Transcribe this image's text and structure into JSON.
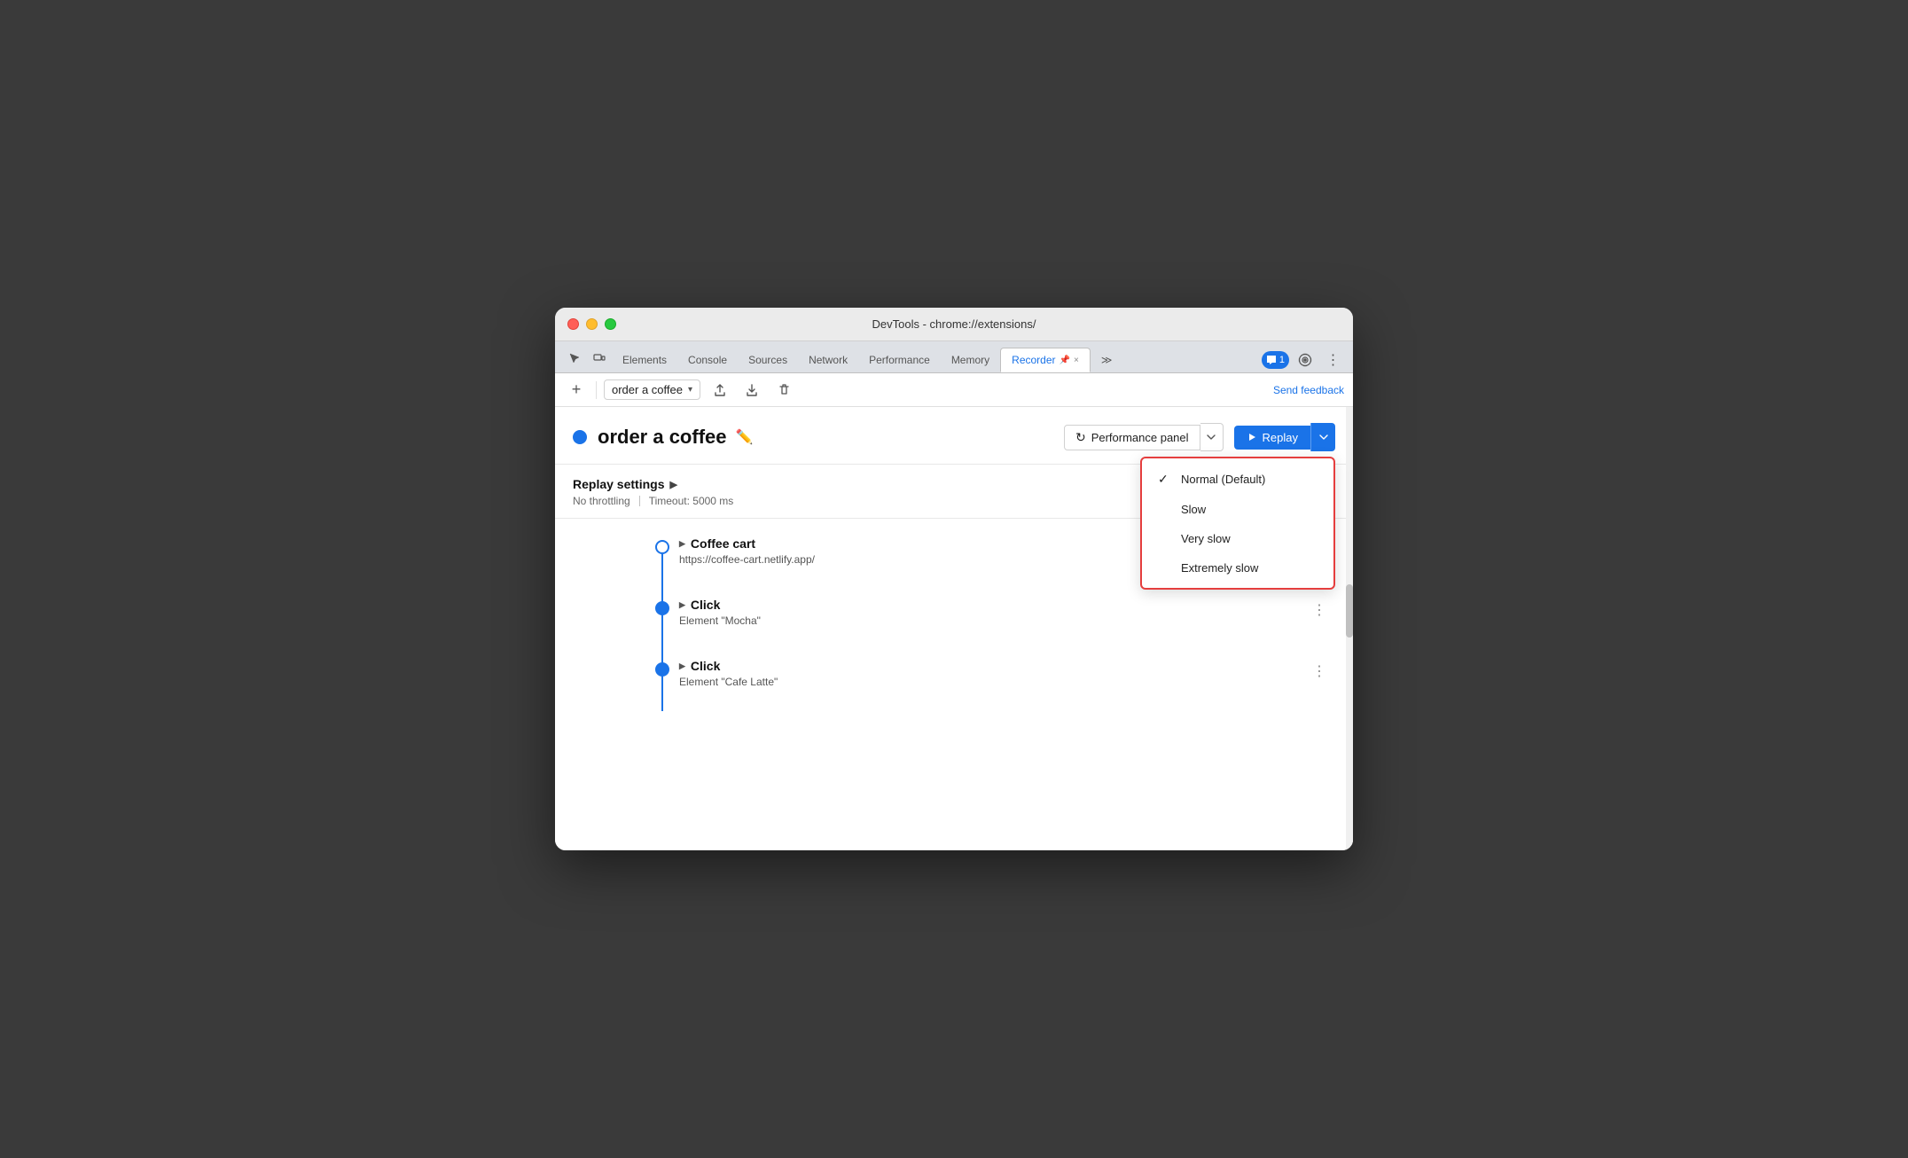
{
  "window": {
    "title": "DevTools - chrome://extensions/"
  },
  "tabs": {
    "items": [
      {
        "label": "Elements",
        "active": false
      },
      {
        "label": "Console",
        "active": false
      },
      {
        "label": "Sources",
        "active": false
      },
      {
        "label": "Network",
        "active": false
      },
      {
        "label": "Performance",
        "active": false
      },
      {
        "label": "Memory",
        "active": false
      },
      {
        "label": "Recorder",
        "active": true
      },
      {
        "label": "≫",
        "active": false
      }
    ],
    "chat_badge": "1",
    "recorder_pin": "📌",
    "recorder_close": "×"
  },
  "toolbar": {
    "add_icon": "+",
    "recording_name": "order a coffee",
    "chevron": "▾",
    "upload_icon": "↑",
    "download_icon": "↓",
    "delete_icon": "🗑",
    "send_feedback": "Send feedback"
  },
  "recording": {
    "title": "order a coffee",
    "edit_icon": "✏️",
    "perf_panel_label": "Performance panel",
    "replay_label": "Replay"
  },
  "replay_settings": {
    "title": "Replay settings",
    "arrow": "▶",
    "no_throttling": "No throttling",
    "timeout": "Timeout: 5000 ms"
  },
  "speed_dropdown": {
    "options": [
      {
        "label": "Normal (Default)",
        "selected": true
      },
      {
        "label": "Slow",
        "selected": false
      },
      {
        "label": "Very slow",
        "selected": false
      },
      {
        "label": "Extremely slow",
        "selected": false
      }
    ]
  },
  "steps": [
    {
      "type": "navigate",
      "title": "Coffee cart",
      "subtitle": "https://coffee-cart.netlify.app/",
      "dot_filled": false
    },
    {
      "type": "click",
      "title": "Click",
      "subtitle": "Element \"Mocha\"",
      "dot_filled": true
    },
    {
      "type": "click",
      "title": "Click",
      "subtitle": "Element \"Cafe Latte\"",
      "dot_filled": true
    }
  ]
}
